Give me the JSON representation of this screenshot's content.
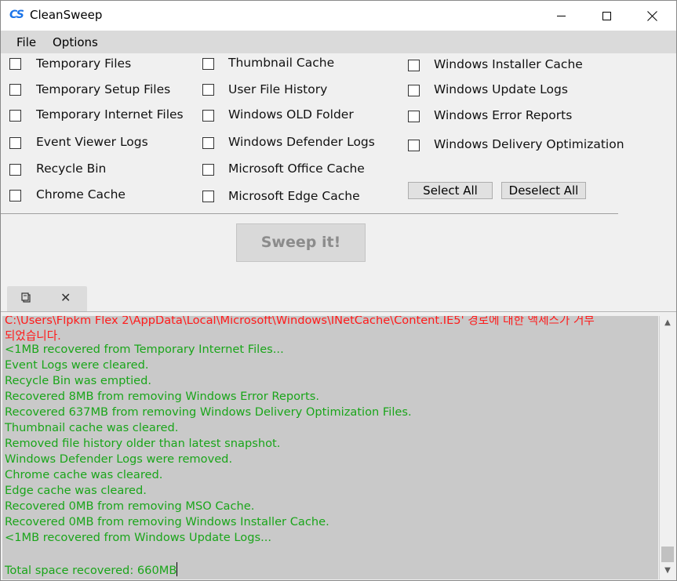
{
  "app": {
    "icon_text": "CS",
    "title": "CleanSweep"
  },
  "window_controls": {
    "minimize": "minimize-icon",
    "maximize": "maximize-icon",
    "close": "close-icon"
  },
  "menu": [
    "File",
    "Options"
  ],
  "options": {
    "col1": [
      "Temporary Files",
      "Temporary Setup Files",
      "Temporary Internet Files",
      "Event Viewer Logs",
      "Recycle Bin",
      "Chrome Cache"
    ],
    "col2": [
      "Thumbnail Cache",
      "User File History",
      "Windows OLD Folder",
      "Windows Defender Logs",
      "Microsoft Office Cache",
      "Microsoft Edge Cache"
    ],
    "col3": [
      "Windows Installer Cache",
      "Windows Update Logs",
      "Windows Error Reports",
      "Windows Delivery Optimization"
    ]
  },
  "buttons": {
    "select_all": "Select All",
    "deselect_all": "Deselect All",
    "sweep": "Sweep it!"
  },
  "log": {
    "lines": [
      {
        "text": "C:\\Users\\Flpkm Flex 2\\AppData\\Local\\Microsoft\\Windows\\INetCache\\Content.IE5' 경로에 대한 액세스가 거부",
        "color": "#ff1a1a"
      },
      {
        "text": "되었습니다.",
        "color": "#ff1a1a"
      },
      {
        "text": "<1MB recovered from Temporary Internet Files...",
        "color": "#1aa51a"
      },
      {
        "text": "Event Logs were cleared.",
        "color": "#1aa51a"
      },
      {
        "text": "Recycle Bin was emptied.",
        "color": "#1aa51a"
      },
      {
        "text": "Recovered 8MB from removing Windows Error Reports.",
        "color": "#1aa51a"
      },
      {
        "text": "Recovered 637MB from removing Windows Delivery Optimization Files.",
        "color": "#1aa51a"
      },
      {
        "text": "Thumbnail cache was cleared.",
        "color": "#1aa51a"
      },
      {
        "text": "Removed file history older than latest snapshot.",
        "color": "#1aa51a"
      },
      {
        "text": "Windows Defender Logs were removed.",
        "color": "#1aa51a"
      },
      {
        "text": "Chrome cache was cleared.",
        "color": "#1aa51a"
      },
      {
        "text": "Edge cache was cleared.",
        "color": "#1aa51a"
      },
      {
        "text": "Recovered 0MB from removing MSO Cache.",
        "color": "#1aa51a"
      },
      {
        "text": "Recovered 0MB from removing Windows Installer Cache.",
        "color": "#1aa51a"
      },
      {
        "text": "<1MB recovered from Windows Update Logs...",
        "color": "#1aa51a"
      },
      {
        "text": "",
        "color": "#1aa51a"
      },
      {
        "text": "Total space recovered: 660MB",
        "color": "#1aa51a"
      }
    ]
  },
  "colors": {
    "error_text": "#ff1a1a",
    "success_text": "#1aa51a",
    "log_background": "#c9c9c9"
  }
}
